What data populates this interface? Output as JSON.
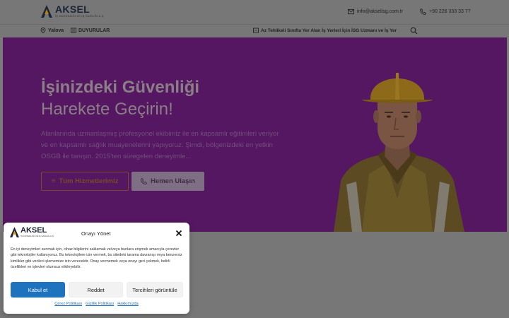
{
  "header": {
    "logo_name": "AKSEL",
    "logo_sub": "İŞ GÜVENLİĞİ VE İŞ SAĞLIĞI A.Ş.",
    "email": "info@akselisg.com.tr",
    "phone": "+90 226 333 33 77"
  },
  "nav": {
    "location": "Yalova",
    "announcements": "DUYURULAR",
    "ticker": "Az Tehlikeli Sınıfta Yer Alan İş Yerleri İçin İSG Uzmanı ve İş Yer"
  },
  "hero": {
    "title_line1": "İşinizdeki Güvenliği",
    "title_line2": "Harekete Geçirin!",
    "text": "Alanlarında uzmanlaşmış profesyonel ekibimiz ile en kapsamlı eğitimleri veriyor ve en kapsamlı sağlık muayenelerini yapıyoruz. Şimdi, bölgenizdeki en yetkin OSGB ile tanışın. 2015'ten süregelen deneyimle...",
    "btn_services": "Tüm Hizmetlerimiz",
    "btn_call": "Hemen Ulaşın"
  },
  "cookie": {
    "logo_name": "AKSEL",
    "logo_sub": "İŞ GÜVENLİĞİ VE İŞ SAĞLIĞI A.Ş.",
    "title": "Onayı Yönet",
    "text": "En iyi deneyimleri sunmak için, cihaz bilgilerini saklamak ve/veya bunlara erişmek amacıyla çerezler gibi teknolojiler kullanıyoruz. Bu teknolojilere izin vermek, bu sitedeki tarama davranışı veya benzersiz kimlikler gibi verileri işlememize izin verecektir. Onay vermemek veya onayı geri çekmek, belirli özellikleri ve işlevleri olumsuz etkileyebilir.",
    "accept": "Kabul et",
    "deny": "Reddet",
    "prefs": "Tercihleri görüntüle",
    "links": [
      "Çerez Politikası",
      "Gizlilik Politikası",
      "Hakkımızda"
    ]
  },
  "colors": {
    "accent": "#1e73be",
    "hero_bg": "#551662",
    "orange": "#f58a1f"
  }
}
